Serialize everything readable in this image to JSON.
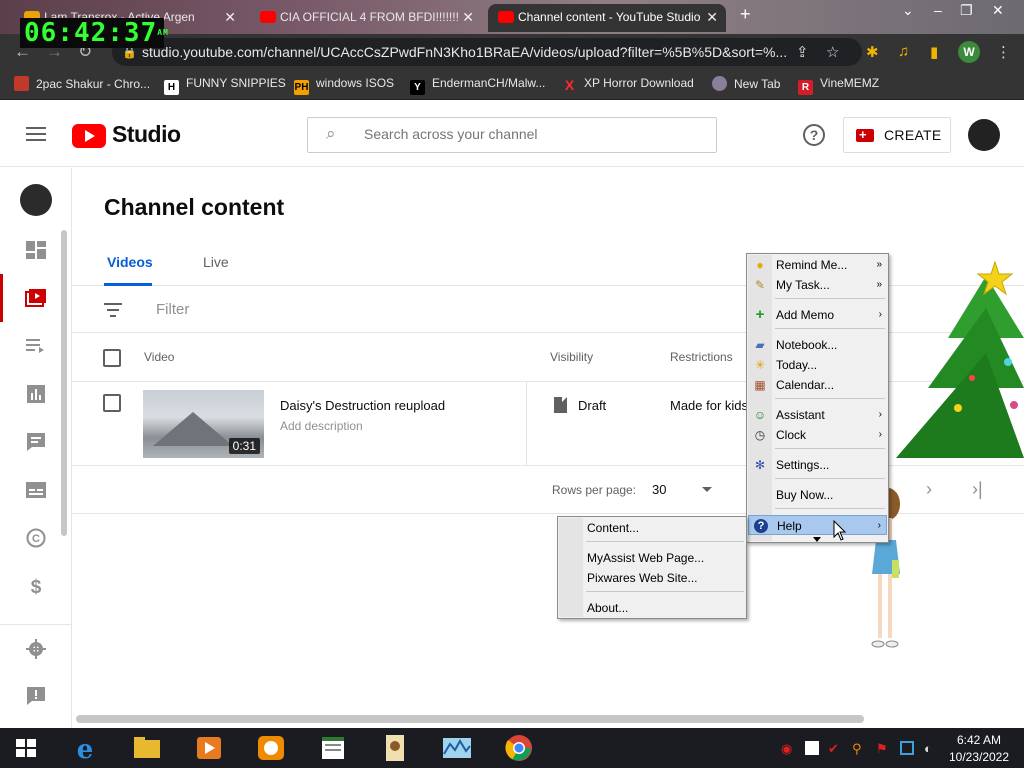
{
  "browser": {
    "tabs": [
      {
        "title": "I am Transrox - Active Argen"
      },
      {
        "title": "CIA OFFICIAL 4 FROM BFDI!!!!!!!"
      },
      {
        "title": "Channel content - YouTube Studio"
      }
    ],
    "overlay_clock": "06:42:37",
    "overlay_clock_ampm": "AM",
    "url": "studio.youtube.com/channel/UCAccCsZPwdFnN3Kho1BRaEA/videos/upload?filter=%5B%5D&sort=%...",
    "profile_initial": "W",
    "bookmarks": [
      {
        "label": "2pac Shakur - Chro..."
      },
      {
        "label": "FUNNY SNIPPIES"
      },
      {
        "label": "windows ISOS"
      },
      {
        "label": "EndermanCH/Malw..."
      },
      {
        "label": "XP Horror Download"
      },
      {
        "label": "New Tab"
      },
      {
        "label": "VineMEMZ"
      }
    ]
  },
  "studio": {
    "logo_text": "Studio",
    "search_placeholder": "Search across your channel",
    "create_label": "CREATE",
    "page_title": "Channel content",
    "tabs": [
      {
        "label": "Videos"
      },
      {
        "label": "Live"
      }
    ],
    "filter_placeholder": "Filter",
    "columns": {
      "video": "Video",
      "visibility": "Visibility",
      "restrictions": "Restrictions"
    },
    "videos": [
      {
        "title": "Daisy's Destruction reupload",
        "description": "Add description",
        "duration": "0:31",
        "visibility": "Draft",
        "restrictions": "Made for kids"
      }
    ],
    "pagination": {
      "rows_per_page_label": "Rows per page:",
      "rows_per_page_value": "30"
    }
  },
  "context_menu": {
    "items": [
      {
        "label": "Remind Me...",
        "has_submenu": true
      },
      {
        "label": "My Task...",
        "has_submenu": true
      },
      {
        "label": "Add Memo",
        "has_submenu": true
      },
      {
        "label": "Notebook..."
      },
      {
        "label": "Today..."
      },
      {
        "label": "Calendar..."
      },
      {
        "label": "Assistant",
        "has_submenu": true
      },
      {
        "label": "Clock",
        "has_submenu": true
      },
      {
        "label": "Settings..."
      },
      {
        "label": "Buy Now..."
      },
      {
        "label": "Help",
        "has_submenu": true,
        "highlighted": true
      }
    ],
    "help_submenu": [
      {
        "label": "Content..."
      },
      {
        "label": "MyAssist Web Page..."
      },
      {
        "label": "Pixwares Web Site..."
      },
      {
        "label": "About..."
      }
    ]
  },
  "taskbar": {
    "time": "6:42 AM",
    "date": "10/23/2022"
  },
  "colors": {
    "accent_blue": "#065fd4",
    "youtube_red": "#ff0000",
    "menu_highlight": "#a9c8ee"
  }
}
